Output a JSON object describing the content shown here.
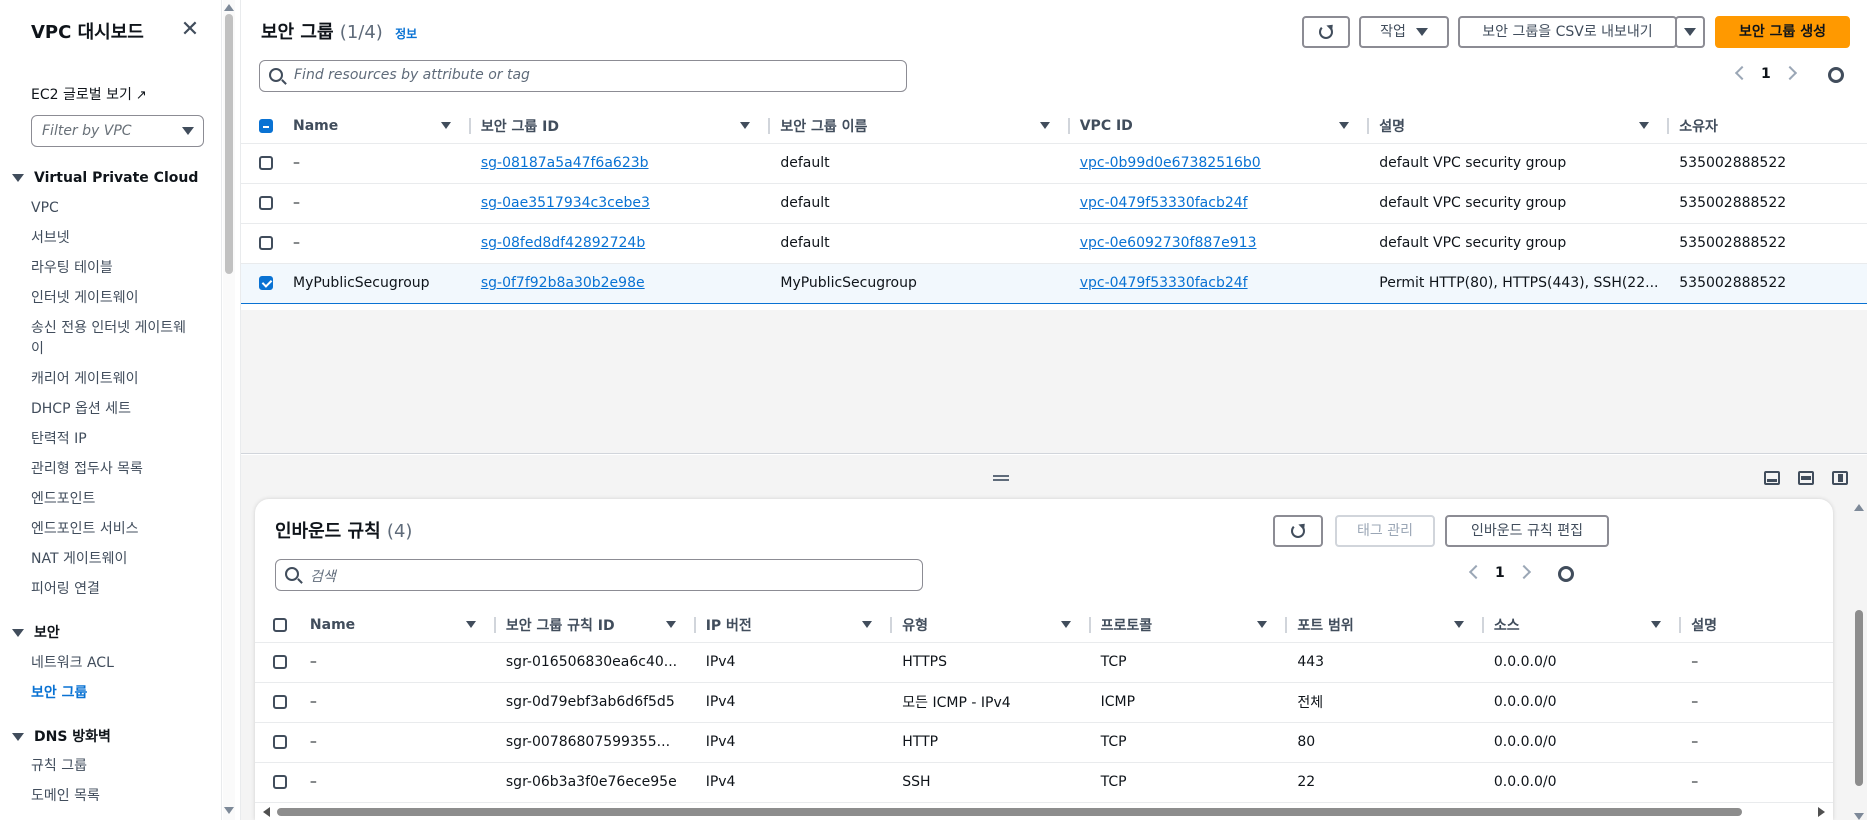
{
  "sidebar": {
    "title": "VPC 대시보드",
    "ec2_global_view": "EC2 글로벌 보기",
    "filter_placeholder": "Filter by VPC",
    "sections": [
      {
        "label": "Virtual Private Cloud",
        "items": [
          "VPC",
          "서브넷",
          "라우팅 테이블",
          "인터넷 게이트웨이",
          "송신 전용 인터넷 게이트웨이",
          "캐리어 게이트웨이",
          "DHCP 옵션 세트",
          "탄력적 IP",
          "관리형 접두사 목록",
          "엔드포인트",
          "엔드포인트 서비스",
          "NAT 게이트웨이",
          "피어링 연결"
        ]
      },
      {
        "label": "보안",
        "items": [
          "네트워크 ACL",
          "보안 그룹"
        ]
      },
      {
        "label": "DNS 방화벽",
        "items": [
          "규칙 그룹",
          "도메인 목록"
        ]
      }
    ],
    "active_item": "보안 그룹"
  },
  "top": {
    "title": "보안 그룹",
    "count": "(1/4)",
    "info": "정보",
    "actions_label": "작업",
    "export_label": "보안 그룹을 CSV로 내보내기",
    "create_label": "보안 그룹 생성",
    "search_placeholder": "Find resources by attribute or tag",
    "page": "1",
    "columns": [
      "Name",
      "보안 그룹 ID",
      "보안 그룹 이름",
      "VPC ID",
      "설명",
      "소유자"
    ],
    "rows": [
      {
        "name": "–",
        "id": "sg-08187a5a47f6a623b",
        "group_name": "default",
        "vpc": "vpc-0b99d0e67382516b0",
        "desc": "default VPC security group",
        "owner": "535002888522",
        "selected": false
      },
      {
        "name": "–",
        "id": "sg-0ae3517934c3cebe3",
        "group_name": "default",
        "vpc": "vpc-0479f53330facb24f",
        "desc": "default VPC security group",
        "owner": "535002888522",
        "selected": false
      },
      {
        "name": "–",
        "id": "sg-08fed8df42892724b",
        "group_name": "default",
        "vpc": "vpc-0e6092730f887e913",
        "desc": "default VPC security group",
        "owner": "535002888522",
        "selected": false
      },
      {
        "name": "MyPublicSecugroup",
        "id": "sg-0f7f92b8a30b2e98e",
        "group_name": "MyPublicSecugroup",
        "vpc": "vpc-0479f53330facb24f",
        "desc": "Permit HTTP(80), HTTPS(443), SSH(22...",
        "owner": "535002888522",
        "selected": true
      }
    ]
  },
  "inbound": {
    "title": "인바운드 규칙",
    "count": "(4)",
    "manage_tags_label": "태그 관리",
    "edit_label": "인바운드 규칙 편집",
    "search_placeholder": "검색",
    "page": "1",
    "columns": [
      "Name",
      "보안 그룹 규칙 ID",
      "IP 버전",
      "유형",
      "프로토콜",
      "포트 범위",
      "소스",
      "설명"
    ],
    "rows": [
      {
        "name": "–",
        "rule_id": "sgr-016506830ea6c40...",
        "ip": "IPv4",
        "type": "HTTPS",
        "protocol": "TCP",
        "port": "443",
        "source": "0.0.0.0/0",
        "desc": "–"
      },
      {
        "name": "–",
        "rule_id": "sgr-0d79ebf3ab6d6f5d5",
        "ip": "IPv4",
        "type": "모든 ICMP - IPv4",
        "protocol": "ICMP",
        "port": "전체",
        "source": "0.0.0.0/0",
        "desc": "–"
      },
      {
        "name": "–",
        "rule_id": "sgr-00786807599355...",
        "ip": "IPv4",
        "type": "HTTP",
        "protocol": "TCP",
        "port": "80",
        "source": "0.0.0.0/0",
        "desc": "–"
      },
      {
        "name": "–",
        "rule_id": "sgr-06b3a3f0e76ece95e",
        "ip": "IPv4",
        "type": "SSH",
        "protocol": "TCP",
        "port": "22",
        "source": "0.0.0.0/0",
        "desc": "–"
      }
    ]
  },
  "colors": {
    "accent": "#0972d3",
    "primary_button": "#ff9900"
  }
}
